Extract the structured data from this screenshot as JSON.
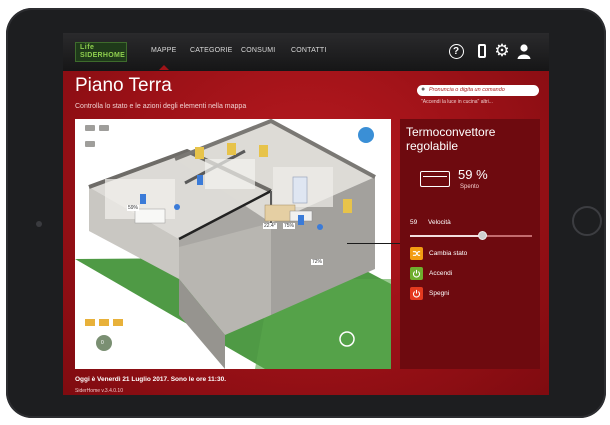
{
  "app": {
    "logo_top": "Life",
    "logo_bottom": "SIDERHOME"
  },
  "nav": {
    "items": [
      {
        "label": "MAPPE",
        "active": true
      },
      {
        "label": "CATEGORIE",
        "active": false
      },
      {
        "label": "CONSUMI",
        "active": false
      },
      {
        "label": "CONTATTI",
        "active": false
      }
    ],
    "icons": [
      "help-icon",
      "smartphone-icon",
      "settings-icon",
      "user-icon"
    ]
  },
  "page": {
    "title": "Piano Terra",
    "subtitle": "Controlla lo stato e le azioni degli elementi nella mappa"
  },
  "search": {
    "placeholder": "Pronuncia o digita un comando",
    "hint": "\"Accendi la luce in cucina\" altri..."
  },
  "map": {
    "badges": [
      "59%",
      "22.4°",
      "75%",
      "72%"
    ],
    "meter_value": "0"
  },
  "device_panel": {
    "name": "Termoconvettore regolabile",
    "value": "59 %",
    "state": "Spento",
    "level_value": "59",
    "level_name": "Velocità",
    "level_fraction": 0.59,
    "actions": [
      {
        "label": "Cambia stato",
        "icon": "shuffle-icon",
        "color": "#f39c12"
      },
      {
        "label": "Accendi",
        "icon": "power-on-icon",
        "color": "#6fae2e"
      },
      {
        "label": "Spegni",
        "icon": "power-off-icon",
        "color": "#e53a1f"
      }
    ]
  },
  "footer": {
    "datetime": "Oggi è Venerdì 21 Luglio 2017. Sono le ore 11:30.",
    "version": "SiderHome v.3.4.0.10"
  },
  "colors": {
    "brand_red": "#9b1117",
    "panel_red": "#6e0a0f",
    "accent_green": "#8fcf4e"
  }
}
